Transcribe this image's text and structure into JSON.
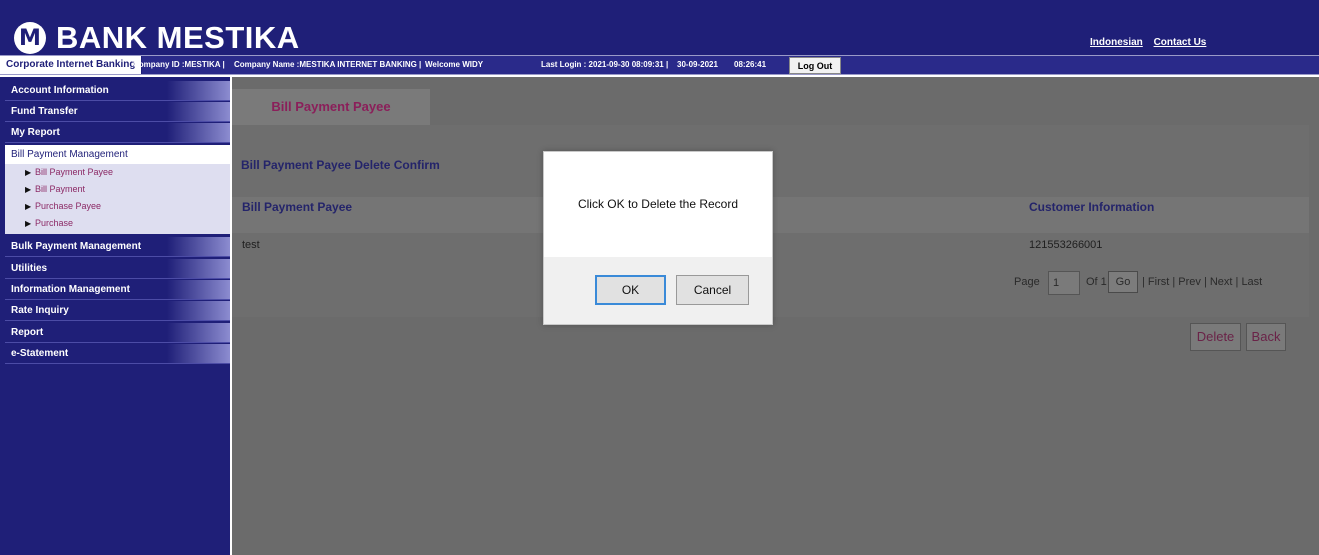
{
  "header": {
    "logo_letter": "M",
    "bank_name": "BANK MESTIKA",
    "links": [
      "Indonesian",
      "Contact Us"
    ]
  },
  "infobar": {
    "product": "Corporate Internet Banking",
    "company_id": "Company ID :MESTIKA  |",
    "company_name": "Company Name :MESTIKA INTERNET BANKING  |",
    "welcome": "Welcome WIDY",
    "last_login": "Last Login : 2021-09-30 08:09:31  |",
    "date": "30-09-2021",
    "time": "08:26:41",
    "logout_label": "Log Out"
  },
  "sidebar": {
    "items_top": [
      "Account Information",
      "Fund Transfer",
      "My Report"
    ],
    "active_item": "Bill Payment Management",
    "sub_items": [
      "Bill Payment Payee",
      "Bill Payment",
      "Purchase Payee",
      "Purchase"
    ],
    "items_bottom": [
      "Bulk Payment Management",
      "Utilities",
      "Information Management",
      "Rate Inquiry",
      "Report",
      "e-Statement"
    ]
  },
  "main": {
    "tab_label": "Bill Payment Payee",
    "confirm_title": "Bill Payment Payee Delete Confirm",
    "columns": [
      "Bill Payment Payee",
      "Customer Information"
    ],
    "rows": [
      [
        "test",
        "121553266001"
      ]
    ],
    "pager": {
      "page_label": "Page",
      "page_value": "1",
      "of_label": "Of 1",
      "go_label": "Go",
      "links": "| First | Prev | Next | Last"
    },
    "delete_label": "Delete",
    "back_label": "Back"
  },
  "modal": {
    "message": "Click OK to Delete the Record",
    "ok_label": "OK",
    "cancel_label": "Cancel"
  },
  "colors": {
    "brand_navy": "#1f1f78",
    "link_maroon": "#8b1f5a",
    "overlay_gray": "#6b6b6b",
    "focus_blue": "#3a8ad8"
  }
}
